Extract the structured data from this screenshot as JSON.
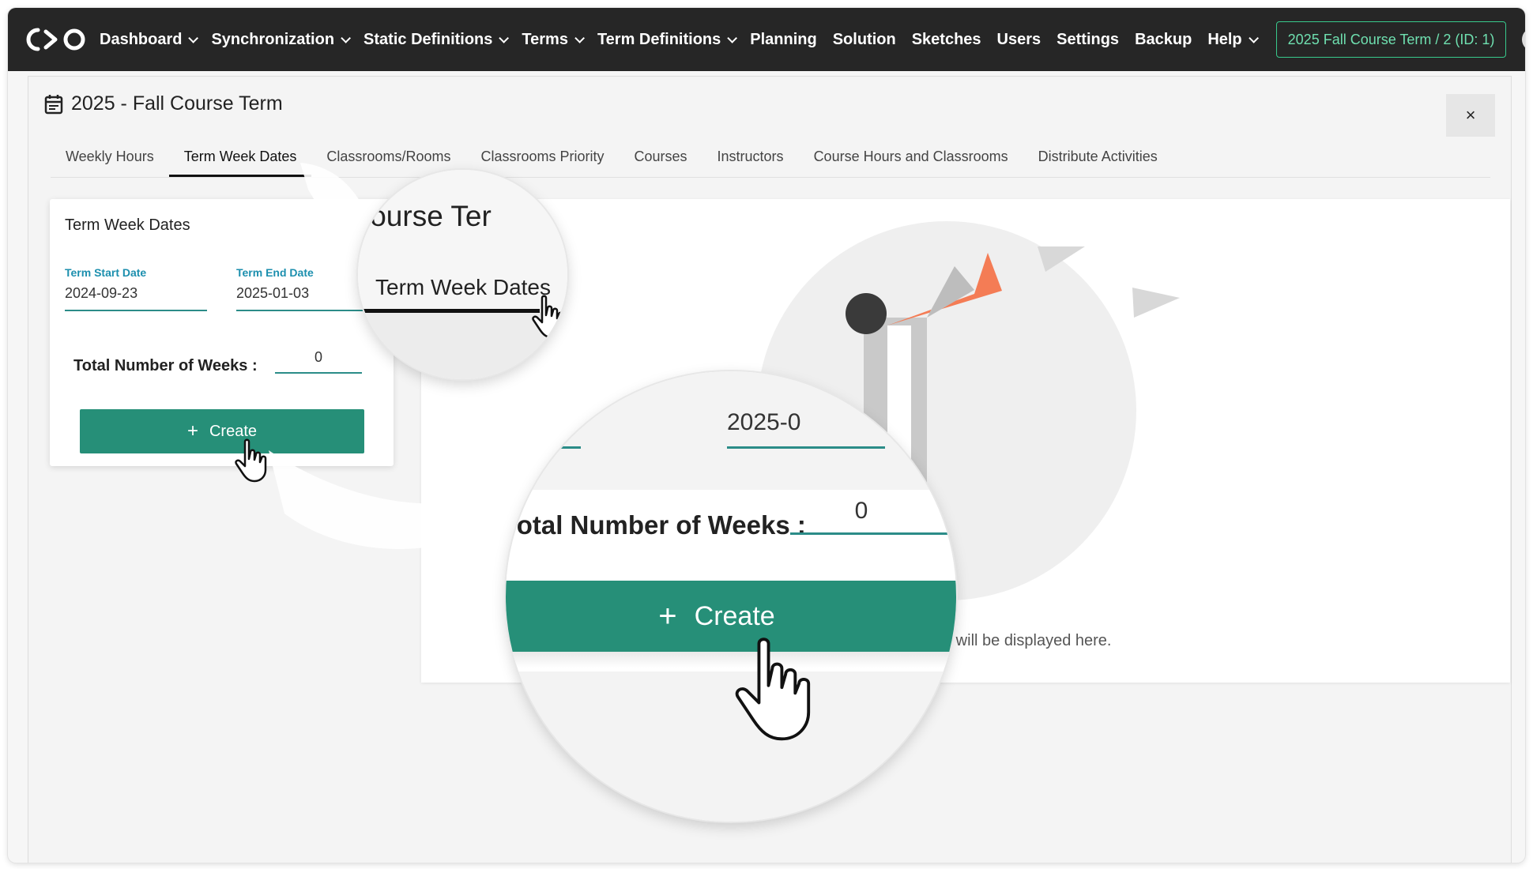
{
  "nav": {
    "logo_text": "C>O",
    "items": [
      {
        "label": "Dashboard",
        "dropdown": true
      },
      {
        "label": "Synchronization",
        "dropdown": true
      },
      {
        "label": "Static Definitions",
        "dropdown": true
      },
      {
        "label": "Terms",
        "dropdown": true
      },
      {
        "label": "Term Definitions",
        "dropdown": true
      },
      {
        "label": "Planning",
        "dropdown": false
      },
      {
        "label": "Solution",
        "dropdown": false
      },
      {
        "label": "Sketches",
        "dropdown": false
      },
      {
        "label": "Users",
        "dropdown": false
      },
      {
        "label": "Settings",
        "dropdown": false
      },
      {
        "label": "Backup",
        "dropdown": false
      },
      {
        "label": "Help",
        "dropdown": true
      }
    ],
    "term_selector": "2025 Fall Course Term / 2 (ID: 1)",
    "icons": [
      "bell-icon",
      "globe-icon",
      "user-icon"
    ]
  },
  "panel": {
    "title": "2025 - Fall Course Term",
    "close_label": "×",
    "tabs": [
      "Weekly Hours",
      "Term Week Dates",
      "Classrooms/Rooms",
      "Classrooms Priority",
      "Courses",
      "Instructors",
      "Course Hours and Classrooms",
      "Distribute Activities"
    ],
    "active_tab": "Term Week Dates"
  },
  "form": {
    "title": "Term Week Dates",
    "start_label": "Term Start Date",
    "start_value": "2024-09-23",
    "end_label": "Term End Date",
    "end_value": "2025-01-03",
    "weeks_label": "Total Number of Weeks :",
    "weeks_value": "0",
    "create_label": "Create",
    "create_icon": "+"
  },
  "empty_state": {
    "text_visible": "es will be displayed here."
  },
  "zoom_top": {
    "title_fragment": "l Course Ter",
    "tab_label": "Term Week Dates"
  },
  "zoom_bottom": {
    "date_fragment": "2025-0",
    "weeks_label": "Total Number of Weeks :",
    "weeks_value": "0",
    "create_label": "Create",
    "create_icon": "+"
  },
  "colors": {
    "nav_bg": "#262626",
    "accent_green": "#268f78",
    "label_blue": "#1c8fae",
    "megaphone": "#f47c55"
  }
}
